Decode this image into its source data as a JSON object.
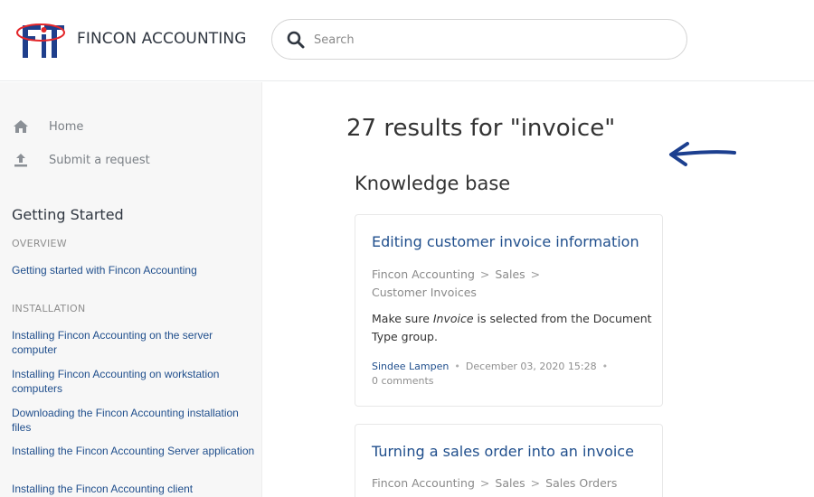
{
  "header": {
    "brand": "FINCON ACCOUNTING",
    "search_placeholder": "Search"
  },
  "sidebar": {
    "nav": [
      {
        "label": "Home",
        "icon": "home-icon"
      },
      {
        "label": "Submit a request",
        "icon": "upload-icon"
      }
    ],
    "heading": "Getting Started",
    "sections": [
      {
        "title": "OVERVIEW",
        "links": [
          "Getting started with Fincon Accounting"
        ]
      },
      {
        "title": "INSTALLATION",
        "links": [
          "Installing Fincon Accounting on the server computer",
          "Installing Fincon Accounting on workstation computers",
          "Downloading the Fincon Accounting installation files",
          "Installing the Fincon Accounting Server application",
          "Installing the Fincon Accounting client"
        ]
      }
    ]
  },
  "main": {
    "results_title": "27 results for \"invoice\"",
    "kb_heading": "Knowledge base",
    "cards": [
      {
        "title": "Editing customer invoice information",
        "crumbs": [
          "Fincon Accounting",
          "Sales"
        ],
        "crumb_last": "Customer Invoices",
        "snippet_pre": "Make sure ",
        "snippet_em": "Invoice",
        "snippet_post": " is selected from the Document Type group.",
        "author": "Sindee Lampen",
        "date": "December 03, 2020 15:28",
        "comments": "0 comments"
      },
      {
        "title": "Turning a sales order into an invoice",
        "crumbs": [
          "Fincon Accounting",
          "Sales",
          "Sales Orders"
        ]
      }
    ]
  },
  "colors": {
    "link": "#1f4e8c",
    "sidebar_bg": "#f7f7f7",
    "arrow": "#1c3f8f",
    "logo_red": "#e3262a",
    "logo_blue": "#1f3f8c"
  }
}
